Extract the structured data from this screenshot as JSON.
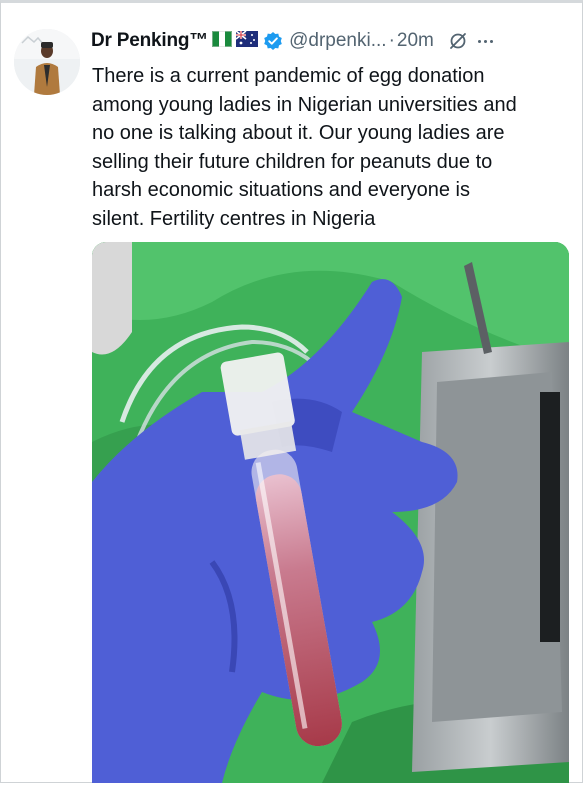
{
  "author": {
    "display_name": "Dr Penking™",
    "handle": "@drpenki...",
    "separator": "·",
    "timestamp": "20m",
    "flags": [
      "nigeria-flag-icon",
      "australia-flag-icon"
    ],
    "verified": true
  },
  "tweet": {
    "text": "There is a current pandemic of egg donation\namong young ladies in Nigerian universities and\nno one is talking about it. Our young ladies are\nselling their future children for peanuts due to\nharsh economic situations and everyone is\nsilent. Fertility centres in Nigeria"
  },
  "colors": {
    "verified_blue": "#1d9bf0",
    "secondary_text": "#536471",
    "primary_text": "#0f1419",
    "glove_purple": "#4f5fd6",
    "drape_green": "#3fb25a"
  }
}
